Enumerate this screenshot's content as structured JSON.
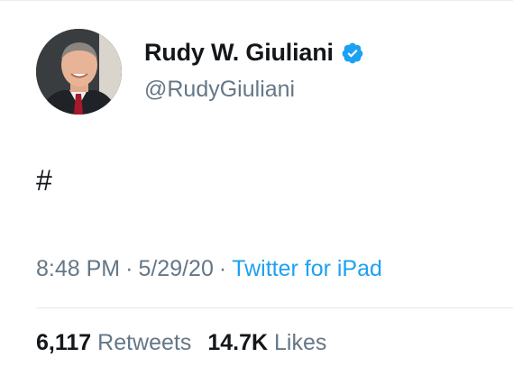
{
  "tweet": {
    "author": {
      "display_name": "Rudy W. Giuliani",
      "handle": "@RudyGiuliani",
      "verified": true
    },
    "text": "#",
    "time": "8:48 PM",
    "date": "5/29/20",
    "separator": "·",
    "source": "Twitter for iPad"
  },
  "stats": {
    "retweets_count": "6,117",
    "retweets_label": "Retweets",
    "likes_count": "14.7K",
    "likes_label": "Likes"
  },
  "colors": {
    "accent": "#1da1f2",
    "secondary_text": "#657786",
    "primary_text": "#14171a"
  },
  "icons": {
    "verified": "verified-badge-icon"
  }
}
